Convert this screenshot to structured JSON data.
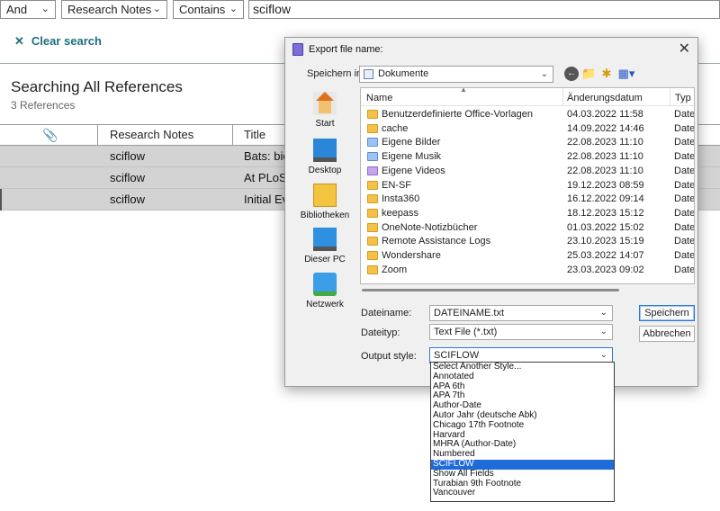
{
  "search_bar": {
    "operator": "And",
    "field": "Research Notes",
    "condition": "Contains",
    "query": "sciflow"
  },
  "clear_search": "Clear search",
  "results": {
    "title": "Searching All References",
    "count": "3 References",
    "columns": [
      "Research Notes",
      "Title"
    ],
    "rows": [
      {
        "notes": "sciflow",
        "title": "Bats: bio"
      },
      {
        "notes": "sciflow",
        "title": "At PLoS"
      },
      {
        "notes": "sciflow",
        "title": "Initial Ev"
      }
    ]
  },
  "dialog": {
    "title": "Export file name:",
    "look_in_label": "Speichern in:",
    "look_in_value": "Dokumente",
    "places": [
      "Start",
      "Desktop",
      "Bibliotheken",
      "Dieser PC",
      "Netzwerk"
    ],
    "columns": {
      "name": "Name",
      "date": "Änderungsdatum",
      "type": "Typ"
    },
    "files": [
      {
        "name": "Benutzerdefinierte Office-Vorlagen",
        "date": "04.03.2022 11:58",
        "type": "Datei",
        "icon": "folder-icon"
      },
      {
        "name": "cache",
        "date": "14.09.2022 14:46",
        "type": "Datei",
        "icon": "folder-icon"
      },
      {
        "name": "Eigene Bilder",
        "date": "22.08.2023 11:10",
        "type": "Datei",
        "icon": "pictures-folder-icon"
      },
      {
        "name": "Eigene Musik",
        "date": "22.08.2023 11:10",
        "type": "Datei",
        "icon": "music-folder-icon"
      },
      {
        "name": "Eigene Videos",
        "date": "22.08.2023 11:10",
        "type": "Datei",
        "icon": "videos-folder-icon"
      },
      {
        "name": "EN-SF",
        "date": "19.12.2023 08:59",
        "type": "Datei",
        "icon": "folder-icon"
      },
      {
        "name": "Insta360",
        "date": "16.12.2022 09:14",
        "type": "Datei",
        "icon": "folder-icon"
      },
      {
        "name": "keepass",
        "date": "18.12.2023 15:12",
        "type": "Datei",
        "icon": "folder-icon"
      },
      {
        "name": "OneNote-Notizbücher",
        "date": "01.03.2022 15:02",
        "type": "Datei",
        "icon": "folder-icon"
      },
      {
        "name": "Remote Assistance Logs",
        "date": "23.10.2023 15:19",
        "type": "Datei",
        "icon": "folder-icon"
      },
      {
        "name": "Wondershare",
        "date": "25.03.2022 14:07",
        "type": "Datei",
        "icon": "folder-icon"
      },
      {
        "name": "Zoom",
        "date": "23.03.2023 09:02",
        "type": "Datei",
        "icon": "folder-icon"
      }
    ],
    "filename_label": "Dateiname:",
    "filename_value": "DATEINAME.txt",
    "filetype_label": "Dateityp:",
    "filetype_value": "Text File (*.txt)",
    "output_style_label": "Output style:",
    "output_style_value": "SCIFLOW",
    "save_button": "Speichern",
    "cancel_button": "Abbrechen",
    "style_options": [
      "Select Another Style...",
      "Annotated",
      "APA 6th",
      "APA 7th",
      "Author-Date",
      "Autor Jahr (deutsche Abk)",
      "Chicago 17th Footnote",
      "Harvard",
      "MHRA (Author-Date)",
      "Numbered",
      "SCIFLOW",
      "Show All Fields",
      "Turabian 9th Footnote",
      "Vancouver"
    ],
    "selected_style_index": 10
  },
  "colors": {
    "accent": "#1d6f7d",
    "selection": "#1f6bd8",
    "row_bg": "#d3d3d3"
  }
}
